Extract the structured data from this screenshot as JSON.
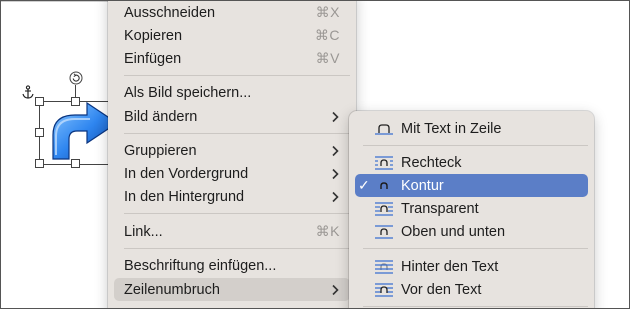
{
  "context_menu": {
    "items": [
      {
        "label": "Ausschneiden",
        "shortcut": "⌘X"
      },
      {
        "label": "Kopieren",
        "shortcut": "⌘C"
      },
      {
        "label": "Einfügen",
        "shortcut": "⌘V"
      },
      {
        "label": "Als Bild speichern..."
      },
      {
        "label": "Bild ändern"
      },
      {
        "label": "Gruppieren"
      },
      {
        "label": "In den Vordergrund"
      },
      {
        "label": "In den Hintergrund"
      },
      {
        "label": "Link...",
        "shortcut": "⌘K"
      },
      {
        "label": "Beschriftung einfügen..."
      },
      {
        "label": "Zeilenumbruch"
      }
    ],
    "highlighted": "Zeilenumbruch"
  },
  "wrap_submenu": {
    "items": [
      {
        "label": "Mit Text in Zeile",
        "icon": "inline-wrap-icon"
      },
      {
        "label": "Rechteck",
        "icon": "square-wrap-icon"
      },
      {
        "label": "Kontur",
        "icon": "tight-wrap-icon",
        "checked": true,
        "check_mark": "✓"
      },
      {
        "label": "Transparent",
        "icon": "through-wrap-icon"
      },
      {
        "label": "Oben und unten",
        "icon": "top-bottom-wrap-icon"
      },
      {
        "label": "Hinter den Text",
        "icon": "behind-text-icon"
      },
      {
        "label": "Vor den Text",
        "icon": "in-front-text-icon"
      }
    ]
  },
  "colors": {
    "menu_bg": "#e7e3df",
    "selection": "#5b7ec7",
    "hover": "#d3cfcb",
    "icon_blue": "#3a6fd0"
  }
}
